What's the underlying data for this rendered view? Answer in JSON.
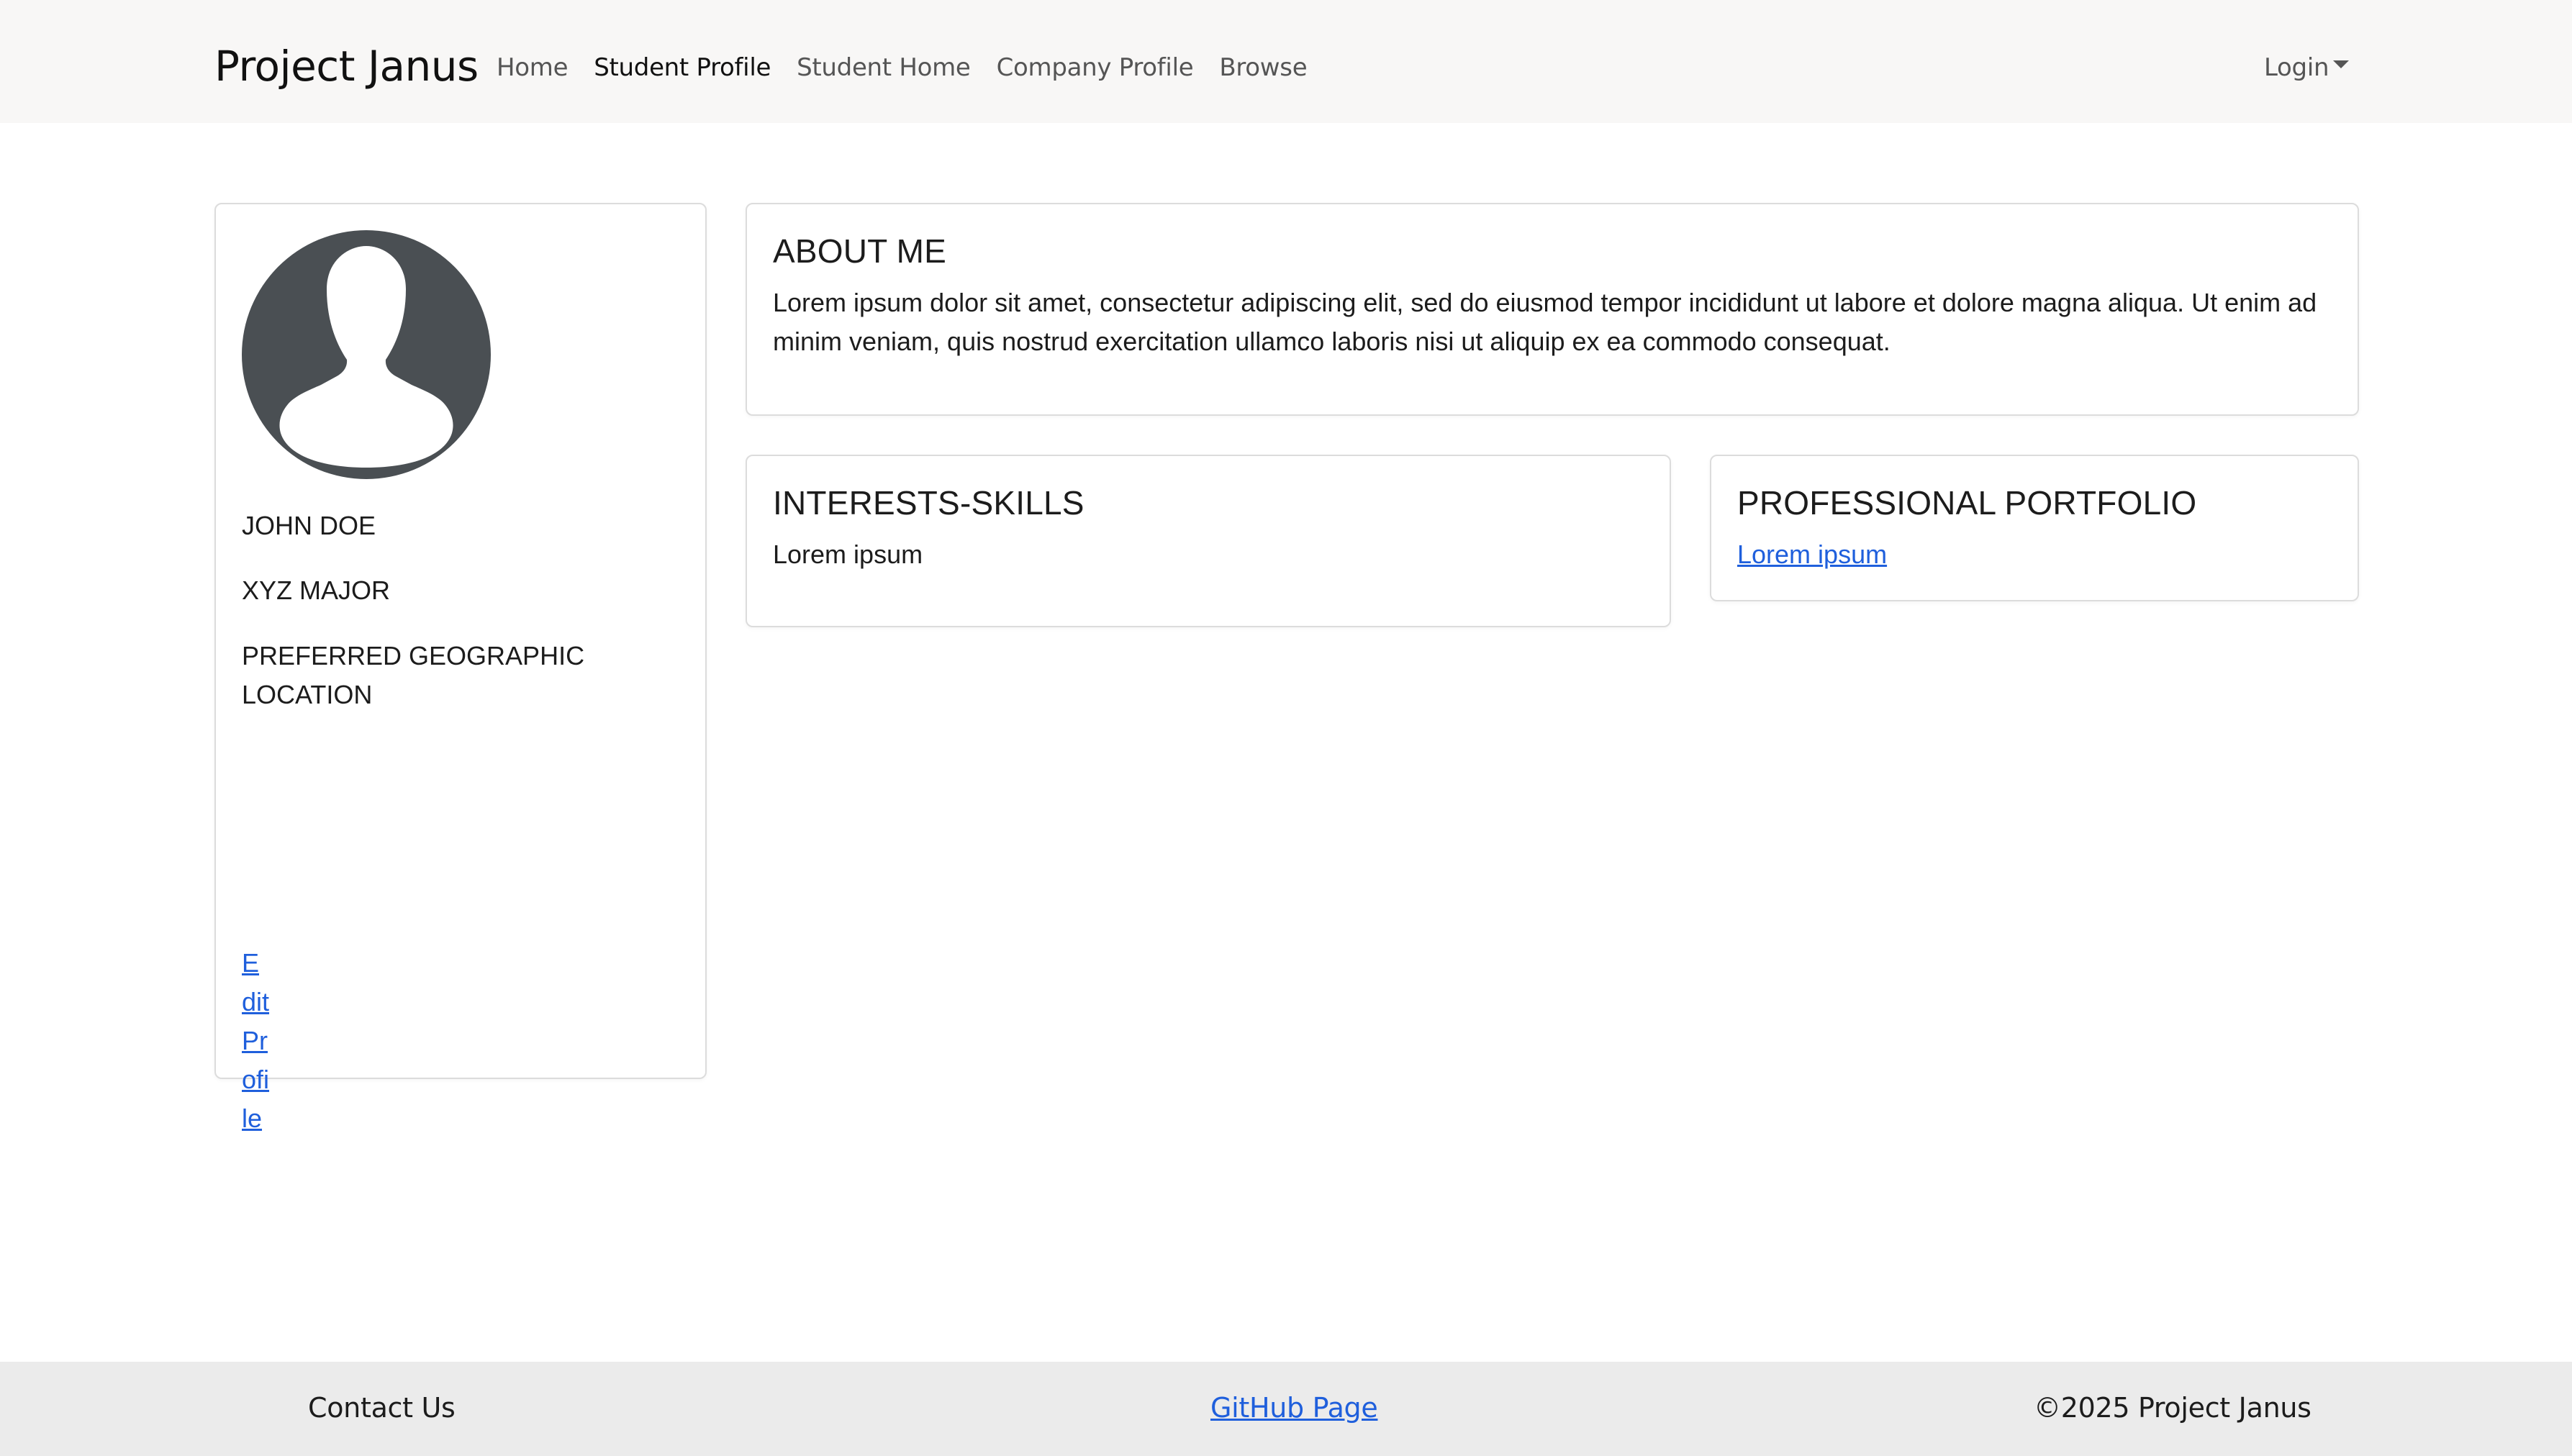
{
  "navbar": {
    "brand": "Project Janus",
    "links": [
      {
        "label": "Home"
      },
      {
        "label": "Student Profile"
      },
      {
        "label": "Student Home"
      },
      {
        "label": "Company Profile"
      },
      {
        "label": "Browse"
      }
    ],
    "active_link": "Student Profile",
    "login": "Login"
  },
  "profile": {
    "avatar_icon": "user-silhouette-icon",
    "name": "JOHN DOE",
    "major": "XYZ MAJOR",
    "location": "PREFERRED GEOGRAPHIC LOCATION",
    "edit_link": "EditProfile"
  },
  "about": {
    "title": "ABOUT ME",
    "text": "Lorem ipsum dolor sit amet, consectetur adipiscing elit, sed do eiusmod tempor incididunt ut labore et dolore magna aliqua. Ut enim ad minim veniam, quis nostrud exercitation ullamco laboris nisi ut aliquip ex ea commodo consequat."
  },
  "skills": {
    "title": "INTERESTS-SKILLS",
    "text": "Lorem ipsum"
  },
  "portfolio": {
    "title": "PROFESSIONAL PORTFOLIO",
    "link": "Lorem ipsum"
  },
  "footer": {
    "contact": "Contact Us",
    "github": "GitHub Page",
    "copyright": "©2025 Project Janus"
  },
  "colors": {
    "navbar_bg": "#f8f7f6",
    "footer_bg": "#ebebeb",
    "link": "#1f5fdc",
    "avatar_bg": "#4a4f53"
  }
}
